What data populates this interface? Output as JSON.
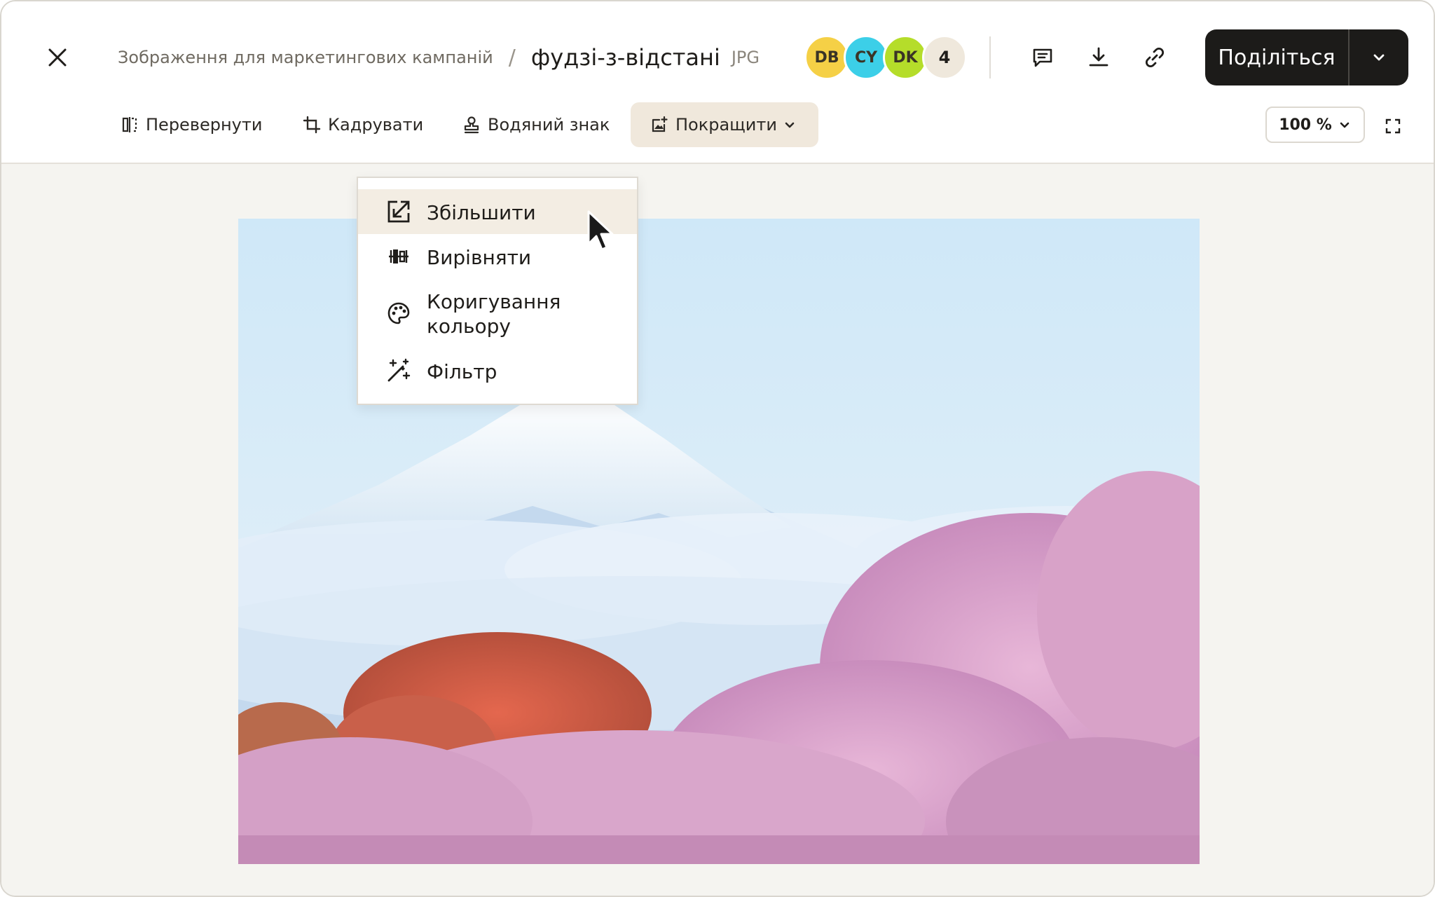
{
  "header": {
    "breadcrumb_parent": "Зображення для маркетингових кампаній",
    "breadcrumb_separator": "/",
    "file_name": "фудзі-з-відстані",
    "file_type": "JPG"
  },
  "collaborators": [
    {
      "initials": "DB",
      "color": "#f5d046"
    },
    {
      "initials": "CY",
      "color": "#3ccfe8"
    },
    {
      "initials": "DK",
      "color": "#b5dd2a"
    }
  ],
  "collaborators_more": "4",
  "actions": {
    "comment_icon": "comment-icon",
    "download_icon": "download-icon",
    "link_icon": "link-icon"
  },
  "share": {
    "label": "Поділіться"
  },
  "toolbar": {
    "flip": "Перевернути",
    "crop": "Кадрувати",
    "watermark": "Водяний знак",
    "enhance": "Покращити",
    "zoom": "100 %"
  },
  "enhance_menu": {
    "items": [
      {
        "label": "Збільшити",
        "icon": "upscale-icon",
        "highlighted": true
      },
      {
        "label": "Вирівняти",
        "icon": "align-icon",
        "highlighted": false
      },
      {
        "label": "Коригування кольору",
        "icon": "palette-icon",
        "highlighted": false
      },
      {
        "label": "Фільтр",
        "icon": "magic-wand-icon",
        "highlighted": false
      }
    ]
  },
  "colors": {
    "share_bg": "#1c1b19",
    "active_tool_bg": "#f0e8dc",
    "canvas_bg": "#f5f4f0"
  }
}
